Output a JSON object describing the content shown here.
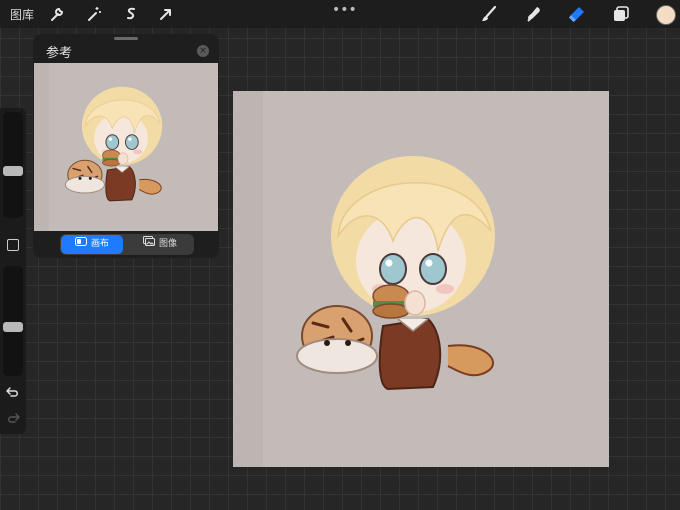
{
  "toolbar": {
    "gallery_label": "图库",
    "more_label": "•••",
    "left_tools": [
      "wrench-icon",
      "magic-wand-icon",
      "selection-icon",
      "transform-arrow-icon"
    ],
    "right_tools": [
      "brush-icon",
      "smudge-icon",
      "eraser-icon",
      "layers-icon"
    ],
    "active_tool": "eraser-icon",
    "current_color": "#f2dcc2",
    "accent": "#1e7bff"
  },
  "sidebar": {
    "brush_size_level": 0.2,
    "opacity_level": 0.2,
    "buttons": [
      "modify-icon",
      "undo-icon",
      "redo-icon"
    ]
  },
  "reference_panel": {
    "title": "参考",
    "close_label": "×",
    "tabs": [
      {
        "label": "画布",
        "icon": "canvas-icon",
        "active": true
      },
      {
        "label": "图像",
        "icon": "image-icon",
        "active": false
      }
    ]
  },
  "canvas": {
    "background": "#c3bbb8",
    "artwork": "chibi-character-with-burger-and-tiger"
  }
}
